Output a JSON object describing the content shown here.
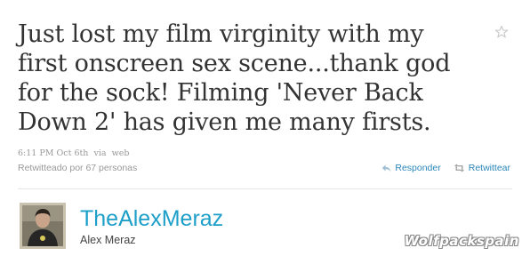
{
  "tweet": {
    "text": "Just lost my film virginity with my first onscreen sex scene...thank god for the sock! Filming 'Never Back Down 2' has given me many firsts.",
    "timestamp": "6:11 PM Oct 6th",
    "via_label": "via",
    "via_source": "web",
    "retweet_info": "Retwitteado por 67 personas",
    "favorite_icon": "star-outline-icon"
  },
  "actions": {
    "reply_label": "Responder",
    "reply_icon": "reply-arrow-icon",
    "retweet_label": "Retwittear",
    "retweet_icon": "retweet-icon"
  },
  "author": {
    "screen_name": "TheAlexMeraz",
    "full_name": "Alex Meraz",
    "avatar_icon": "user-photo-avatar"
  },
  "watermark": {
    "text": "Wolfpackspain"
  },
  "colors": {
    "text": "#333333",
    "meta": "#999999",
    "link": "#2a86b8",
    "screen_name": "#1d9fc9"
  }
}
